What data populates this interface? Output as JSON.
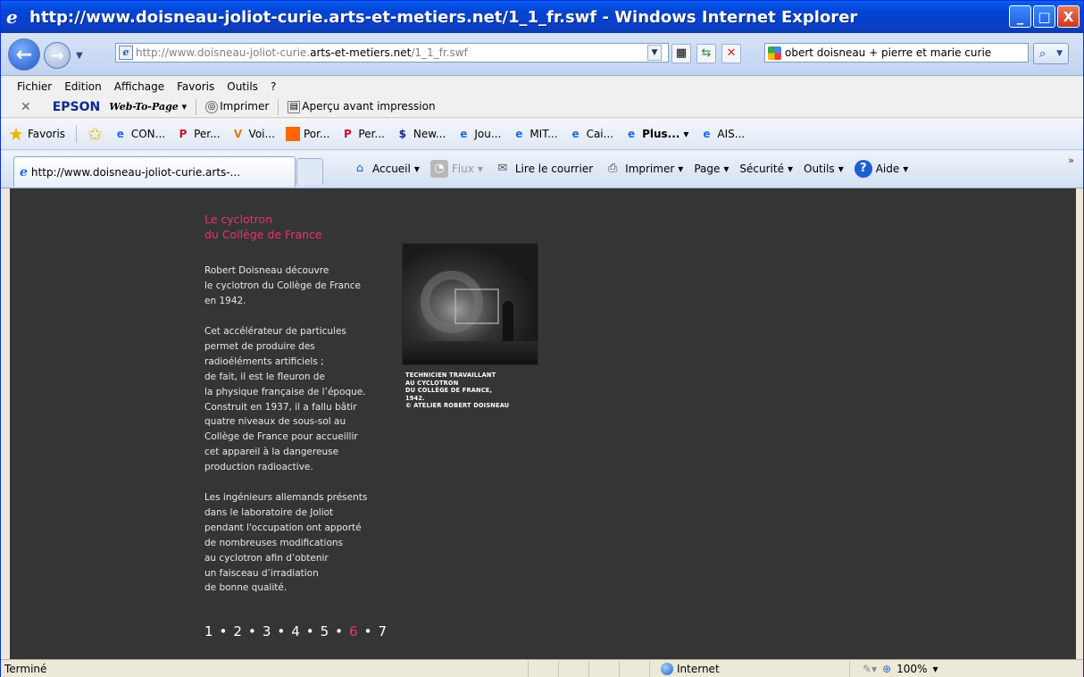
{
  "window": {
    "title": "http://www.doisneau-joliot-curie.arts-et-metiers.net/1_1_fr.swf - Windows Internet Explorer",
    "controls": [
      "_",
      "□",
      "X"
    ]
  },
  "address": {
    "url_prefix": "http://www.doisneau-joliot-curie.",
    "url_host": "arts-et-metiers.net",
    "url_suffix": "/1_1_fr.swf",
    "search_value": "obert doisneau + pierre et marie curie"
  },
  "menu": [
    "Fichier",
    "Edition",
    "Affichage",
    "Favoris",
    "Outils",
    "?"
  ],
  "epson": {
    "brand": "EPSON",
    "web_to_page": "Web-To-Page",
    "print": "Imprimer",
    "preview": "Aperçu avant impression"
  },
  "favorites": {
    "label": "Favoris",
    "items": [
      {
        "icon": "ie-icon",
        "label": "CON..."
      },
      {
        "icon": "p-icon",
        "label": "Per..."
      },
      {
        "icon": "v-icon",
        "label": "Voi..."
      },
      {
        "icon": "orange-icon",
        "label": "Por..."
      },
      {
        "icon": "p-icon",
        "label": "Per..."
      },
      {
        "icon": "s-icon",
        "label": "New..."
      },
      {
        "icon": "ie-icon",
        "label": "Jou..."
      },
      {
        "icon": "ie-icon",
        "label": "MIT..."
      },
      {
        "icon": "ie-icon",
        "label": "Cai..."
      },
      {
        "icon": "ie-icon",
        "label": "Plus..."
      },
      {
        "icon": "ie-icon",
        "label": "AIS..."
      }
    ]
  },
  "tabs": {
    "active_label": "http://www.doisneau-joliot-curie.arts-..."
  },
  "commands": {
    "home": "Accueil",
    "feeds": "Flux",
    "mail": "Lire le courrier",
    "print": "Imprimer",
    "page": "Page",
    "security": "Sécurité",
    "tools": "Outils",
    "help": "Aide"
  },
  "content": {
    "title_line1": "Le cyclotron",
    "title_line2": "du Collège de France",
    "para1": "Robert Doisneau découvre\nle cyclotron du Collège de France\nen 1942.",
    "para2": "Cet accélérateur de particules\npermet de produire des\nradioéléments artificiels ;\nde fait, il est le fleuron de\nla physique française de l’époque.\nConstruit en 1937, il a fallu bâtir\nquatre niveaux de sous-sol au\nCollège de France pour accueillir\ncet appareil à la dangereuse\nproduction radioactive.",
    "para3": "Les ingénieurs allemands présents\ndans le laboratoire de Joliot\npendant l'occupation ont apporté\nde nombreuses modifications\nau cyclotron afin d’obtenir\nun faisceau d’irradiation\nde bonne qualité.",
    "caption": "TECHNICIEN TRAVAILLANT\nAU CYCLOTRON\nDU COLLÈGE DE FRANCE,\n1942.\n© ATELIER ROBERT DOISNEAU",
    "pages": [
      "1",
      "•",
      "2",
      "•",
      "3",
      "•",
      "4",
      "•",
      "5",
      "•",
      "6",
      "•",
      "7"
    ],
    "current_page": "6",
    "accent_color": "#e6376b"
  },
  "status": {
    "text": "Terminé",
    "zone": "Internet",
    "zoom": "100%"
  }
}
